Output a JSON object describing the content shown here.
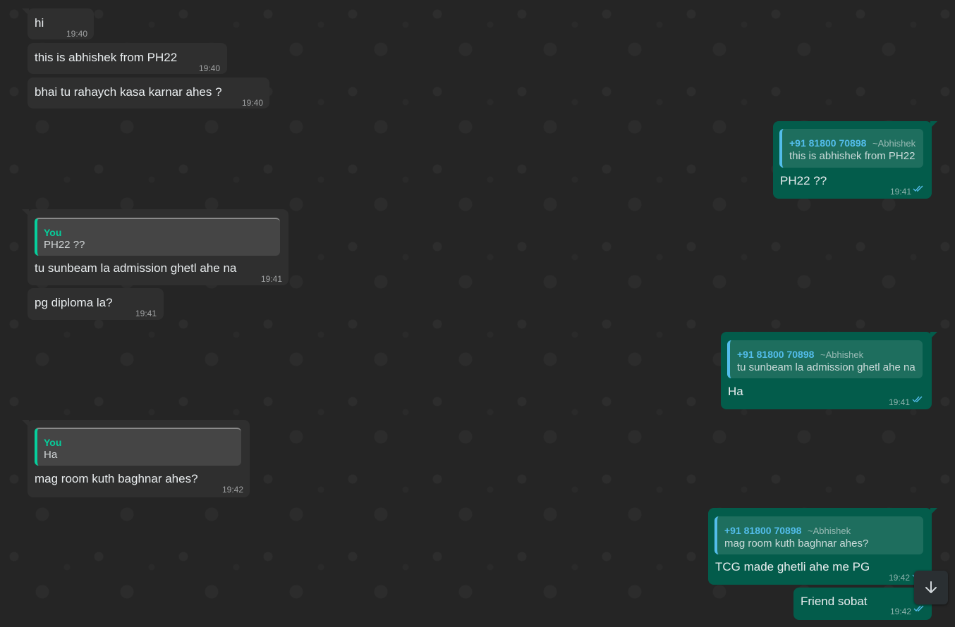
{
  "colors": {
    "background": "#252525",
    "incoming_bubble": "#2f2f2f",
    "outgoing_bubble": "#035c4b",
    "quote_you_accent": "#06cf9c",
    "quote_contact_accent": "#53bdeb",
    "read_ticks": "#53bdeb"
  },
  "messages": [
    {
      "direction": "in",
      "text": "hi",
      "time": "19:40"
    },
    {
      "direction": "in",
      "text": "this is abhishek from PH22",
      "time": "19:40"
    },
    {
      "direction": "in",
      "text": "bhai tu rahaych kasa karnar ahes ?",
      "time": "19:40"
    },
    {
      "direction": "out",
      "quote": {
        "author": "+91 81800 70898",
        "name": "~Abhishek",
        "text": "this is abhishek from PH22"
      },
      "text": "PH22 ??",
      "time": "19:41",
      "status": "read"
    },
    {
      "direction": "in",
      "quote": {
        "author": "You",
        "text": "PH22 ??"
      },
      "text": "tu sunbeam la admission ghetl ahe na",
      "time": "19:41"
    },
    {
      "direction": "in",
      "text": "pg diploma la?",
      "time": "19:41"
    },
    {
      "direction": "out",
      "quote": {
        "author": "+91 81800 70898",
        "name": "~Abhishek",
        "text": "tu sunbeam la admission ghetl ahe na"
      },
      "text": "Ha",
      "time": "19:41",
      "status": "read"
    },
    {
      "direction": "in",
      "quote": {
        "author": "You",
        "text": "Ha"
      },
      "text": "mag room kuth baghnar ahes?",
      "time": "19:42"
    },
    {
      "direction": "out",
      "quote": {
        "author": "+91 81800 70898",
        "name": "~Abhishek",
        "text": "mag room kuth baghnar ahes?"
      },
      "text": "TCG made ghetli ahe me PG",
      "time": "19:42",
      "status": "read"
    },
    {
      "direction": "out",
      "text": "Friend sobat",
      "time": "19:42",
      "status": "read"
    }
  ],
  "scroll_button": {
    "icon": "arrow-down-icon"
  }
}
